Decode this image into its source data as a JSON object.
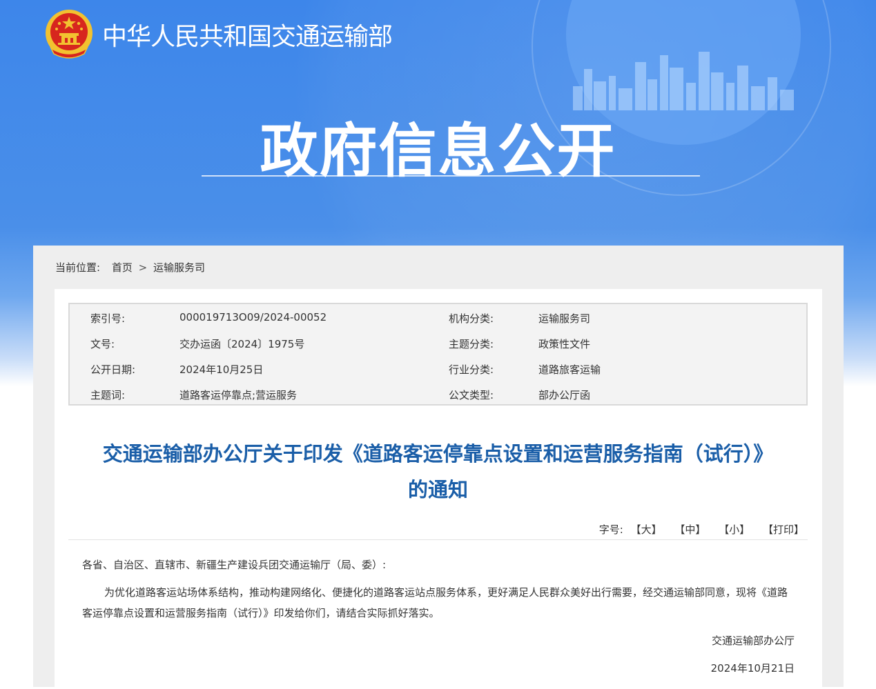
{
  "header": {
    "ministry_name": "中华人民共和国交通运输部",
    "section_title": "政府信息公开"
  },
  "breadcrumb": {
    "label": "当前位置:",
    "items": [
      "首页",
      "运输服务司"
    ],
    "separator": ">"
  },
  "metadata": {
    "rows": [
      {
        "k1": "索引号:",
        "v1": "000019713O09/2024-00052",
        "k2": "机构分类:",
        "v2": "运输服务司"
      },
      {
        "k1": "文号:",
        "v1": "交办运函〔2024〕1975号",
        "k2": "主题分类:",
        "v2": "政策性文件"
      },
      {
        "k1": "公开日期:",
        "v1": "2024年10月25日",
        "k2": "行业分类:",
        "v2": "道路旅客运输"
      },
      {
        "k1": "主题词:",
        "v1": "道路客运停靠点;营运服务",
        "k2": "公文类型:",
        "v2": "部办公厅函"
      }
    ]
  },
  "document": {
    "title_line1": "交通运输部办公厅关于印发《道路客运停靠点设置和运营服务指南（试行）》",
    "title_line2": "的通知",
    "salutation": "各省、自治区、直辖市、新疆生产建设兵团交通运输厅（局、委）:",
    "body": "为优化道路客运站场体系结构，推动构建网络化、便捷化的道路客运站点服务体系，更好满足人民群众美好出行需要，经交通运输部同意，现将《道路客运停靠点设置和运营服务指南（试行）》印发给你们，请结合实际抓好落实。",
    "signoff_org": "交通运输部办公厅",
    "signoff_date": "2024年10月21日"
  },
  "font_tools": {
    "label": "字号:",
    "large": "【大】",
    "medium": "【中】",
    "small": "【小】",
    "print": "【打印】"
  },
  "colors": {
    "banner_blue": "#3d86ea",
    "title_blue": "#1a5ea8",
    "emblem_red": "#d7261e",
    "emblem_gold": "#f2c230"
  }
}
